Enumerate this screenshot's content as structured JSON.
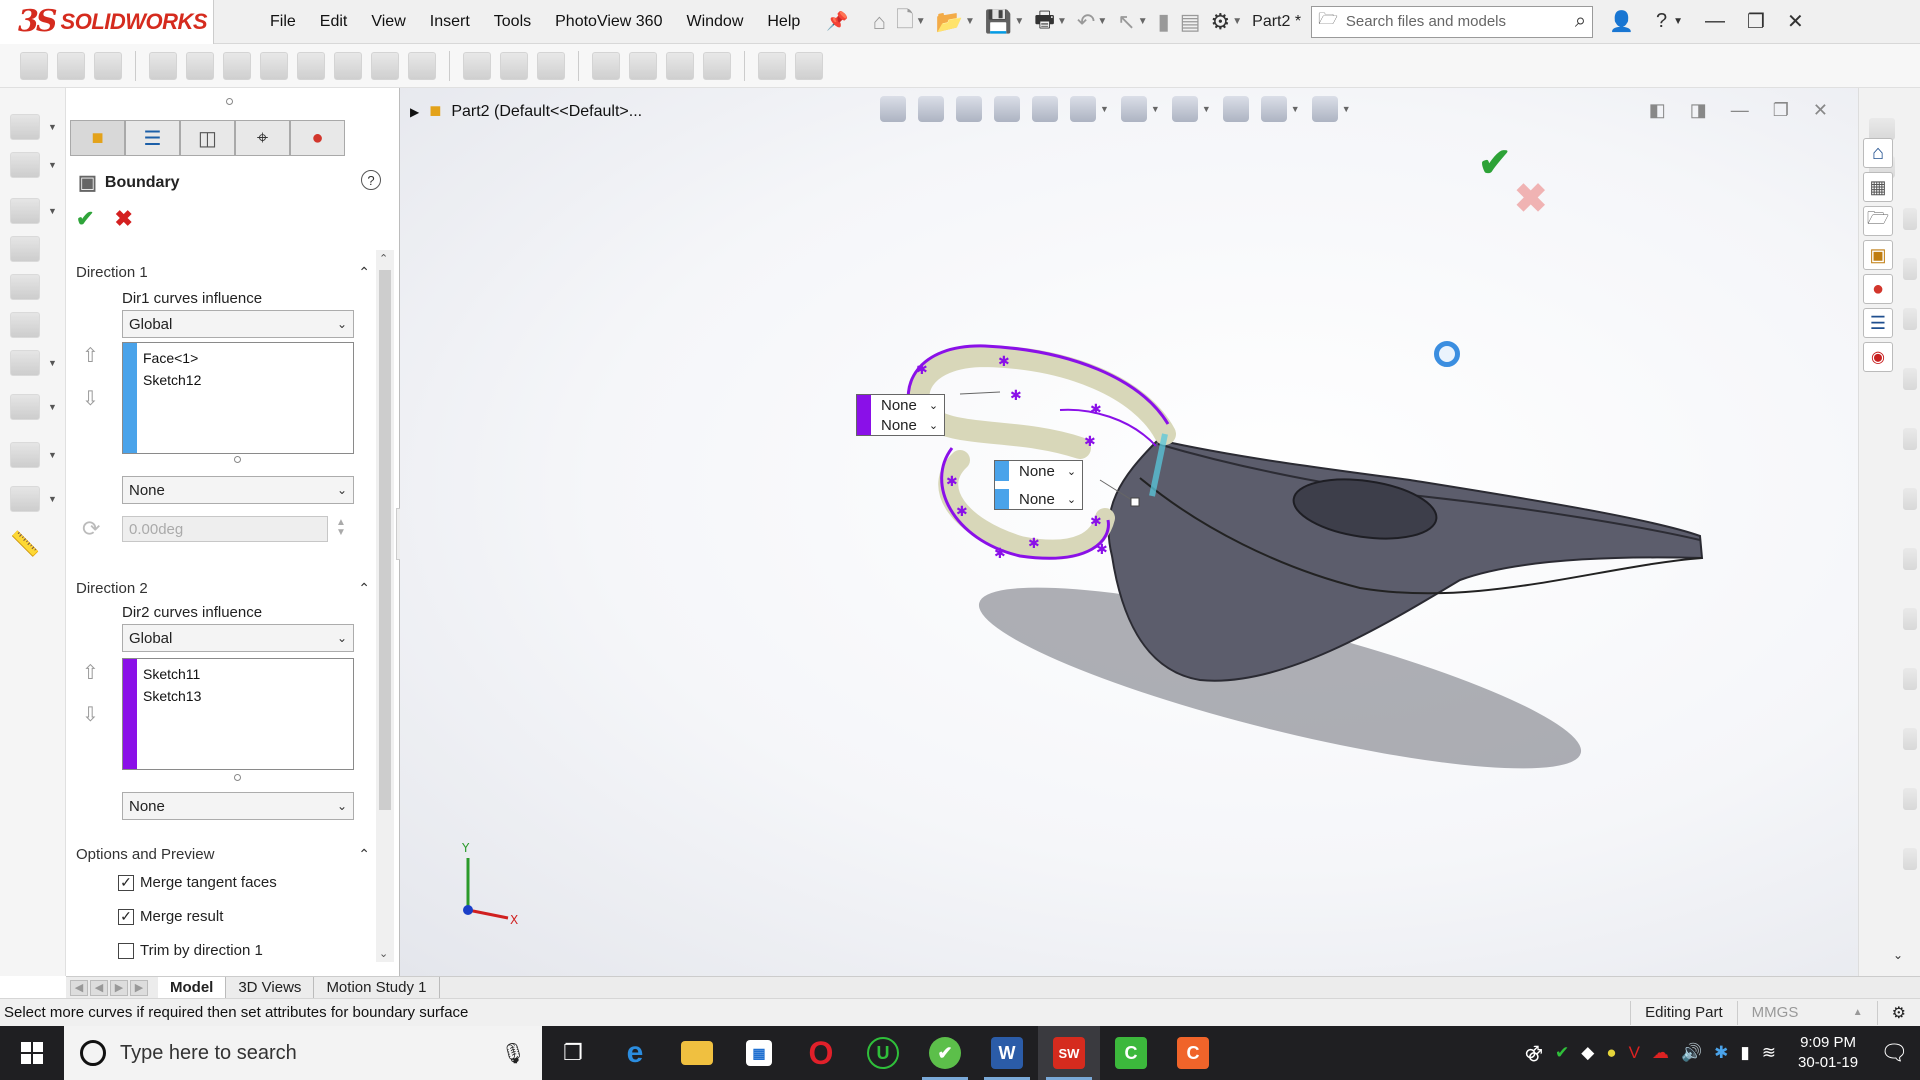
{
  "app": {
    "brand": "SOLIDWORKS",
    "menu": [
      "File",
      "Edit",
      "View",
      "Insert",
      "Tools",
      "PhotoView 360",
      "Window",
      "Help"
    ],
    "document_title": "Part2 *",
    "search_placeholder": "Search files and models"
  },
  "panel": {
    "title": "Boundary",
    "direction1": {
      "heading": "Direction 1",
      "influence_label": "Dir1 curves influence",
      "influence_value": "Global",
      "items": [
        "Face<1>",
        "Sketch12"
      ],
      "tangency_value": "None",
      "angle_value": "0.00deg"
    },
    "direction2": {
      "heading": "Direction 2",
      "influence_label": "Dir2 curves influence",
      "influence_value": "Global",
      "items": [
        "Sketch11",
        "Sketch13"
      ],
      "tangency_value": "None"
    },
    "options": {
      "heading": "Options and Preview",
      "merge_tangent_faces": "Merge tangent faces",
      "merge_result": "Merge result",
      "trim_by_direction1": "Trim by direction 1",
      "merge_tangent_checked": true,
      "merge_result_checked": true,
      "trim_checked": false
    }
  },
  "graphics": {
    "breadcrumb": "Part2  (Default<<Default>...",
    "callout1": [
      "None",
      "None"
    ],
    "callout2": [
      "None",
      "None"
    ],
    "triad_y": "Y",
    "triad_x": "X"
  },
  "bottom_tabs": [
    "Model",
    "3D Views",
    "Motion Study 1"
  ],
  "status": {
    "message": "Select more curves if required then set attributes for boundary surface",
    "mode": "Editing Part",
    "units": "MMGS"
  },
  "taskbar": {
    "search_placeholder": "Type here to search",
    "time": "9:09 PM",
    "date": "30-01-19"
  },
  "colors": {
    "accent_red": "#d52b1e",
    "dir1_tag": "#4aa3ea",
    "dir2_tag": "#8a10e8",
    "ok_green": "#2fa43a",
    "cancel_red": "#d42020"
  }
}
